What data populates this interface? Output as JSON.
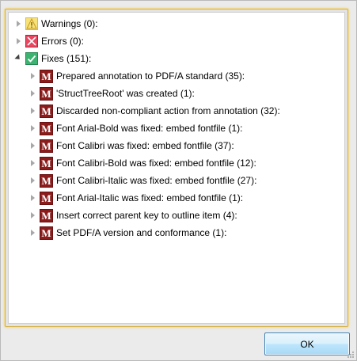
{
  "tree": {
    "warnings": {
      "label": "Warnings (0):",
      "icon": "warning-icon"
    },
    "errors": {
      "label": "Errors (0):",
      "icon": "error-icon"
    },
    "fixes": {
      "label": "Fixes (151):",
      "icon": "checkmark-icon",
      "items": [
        {
          "label": "Prepared annotation to PDF/A standard (35):"
        },
        {
          "label": "'StructTreeRoot' was created (1):"
        },
        {
          "label": "Discarded non-compliant action from annotation (32):"
        },
        {
          "label": "Font Arial-Bold was fixed: embed fontfile (1):"
        },
        {
          "label": "Font Calibri was fixed: embed fontfile (37):"
        },
        {
          "label": "Font Calibri-Bold was fixed: embed fontfile (12):"
        },
        {
          "label": "Font Calibri-Italic was fixed: embed fontfile (27):"
        },
        {
          "label": "Font Arial-Italic was fixed: embed fontfile (1):"
        },
        {
          "label": "Insert correct parent key to outline item (4):"
        },
        {
          "label": "Set PDF/A version and conformance (1):"
        }
      ],
      "item_icon_glyph": "M"
    }
  },
  "buttons": {
    "ok_label": "OK"
  },
  "colors": {
    "accent_border": "#d6b24a",
    "fix_icon": "#8c1c1c",
    "ok_border": "#3c7fb1"
  }
}
